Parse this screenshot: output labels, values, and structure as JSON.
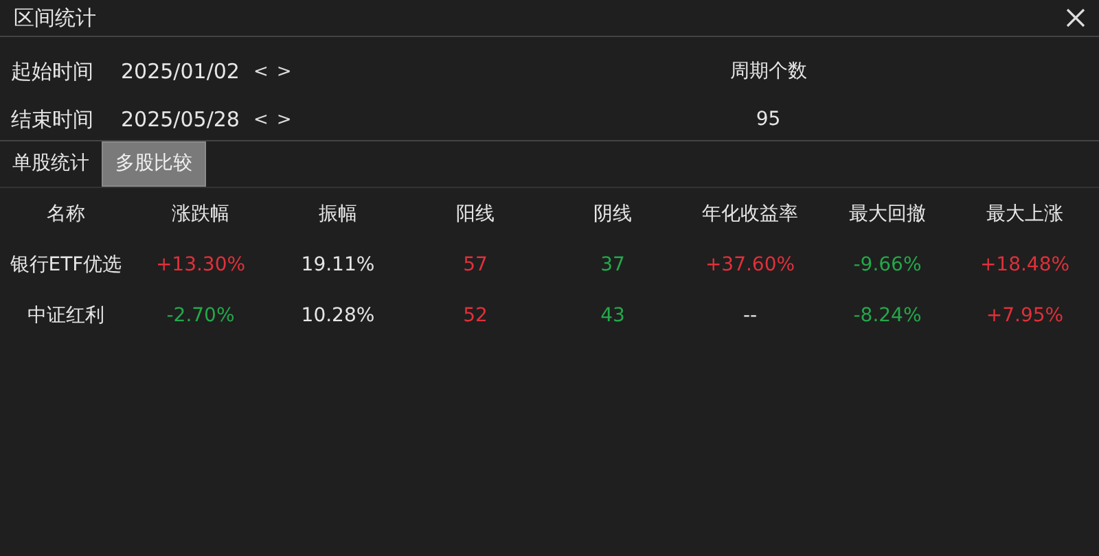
{
  "window": {
    "title": "区间统计"
  },
  "range": {
    "start_label": "起始时间",
    "start_date": "2025/01/02",
    "end_label": "结束时间",
    "end_date": "2025/05/28",
    "prev": "<",
    "next": ">",
    "period_label": "周期个数",
    "period_count": "95"
  },
  "tabs": [
    {
      "label": "单股统计",
      "selected": false
    },
    {
      "label": "多股比较",
      "selected": true
    }
  ],
  "table": {
    "columns": [
      "名称",
      "涨跌幅",
      "振幅",
      "阳线",
      "阴线",
      "年化收益率",
      "最大回撤",
      "最大上涨"
    ],
    "rows": [
      [
        {
          "text": "银行ETF优选",
          "color": "#e6e6e6"
        },
        {
          "text": "+13.30%",
          "color": "#e0303a"
        },
        {
          "text": "19.11%",
          "color": "#e6e6e6"
        },
        {
          "text": "57",
          "color": "#e0303a"
        },
        {
          "text": "37",
          "color": "#23a84a"
        },
        {
          "text": "+37.60%",
          "color": "#e0303a"
        },
        {
          "text": "-9.66%",
          "color": "#23a84a"
        },
        {
          "text": "+18.48%",
          "color": "#e0303a"
        }
      ],
      [
        {
          "text": "中证红利",
          "color": "#e6e6e6"
        },
        {
          "text": "-2.70%",
          "color": "#23a84a"
        },
        {
          "text": "10.28%",
          "color": "#e6e6e6"
        },
        {
          "text": "52",
          "color": "#e0303a"
        },
        {
          "text": "43",
          "color": "#23a84a"
        },
        {
          "text": "--",
          "color": "#e6e6e6"
        },
        {
          "text": "-8.24%",
          "color": "#23a84a"
        },
        {
          "text": "+7.95%",
          "color": "#e0303a"
        }
      ]
    ]
  }
}
